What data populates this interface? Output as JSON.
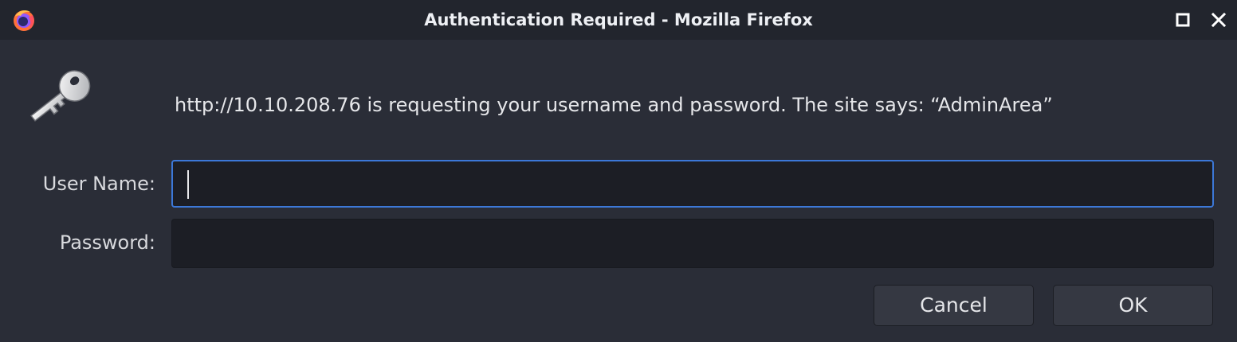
{
  "window": {
    "title": "Authentication Required - Mozilla Firefox",
    "app_icon": "firefox-icon",
    "controls": [
      "maximize-icon",
      "close-icon"
    ]
  },
  "dialog": {
    "icon": "key-icon",
    "message": "http://10.10.208.76 is requesting your username and password. The site says: “AdminArea”",
    "username": {
      "label": "User Name:",
      "value": "",
      "focused": true
    },
    "password": {
      "label": "Password:",
      "value": ""
    },
    "buttons": {
      "cancel": "Cancel",
      "ok": "OK"
    }
  },
  "colors": {
    "background": "#2a2d37",
    "titlebar": "#22252d",
    "field": "#1c1e25",
    "focus_ring": "#3c78d8",
    "button": "#353842"
  }
}
